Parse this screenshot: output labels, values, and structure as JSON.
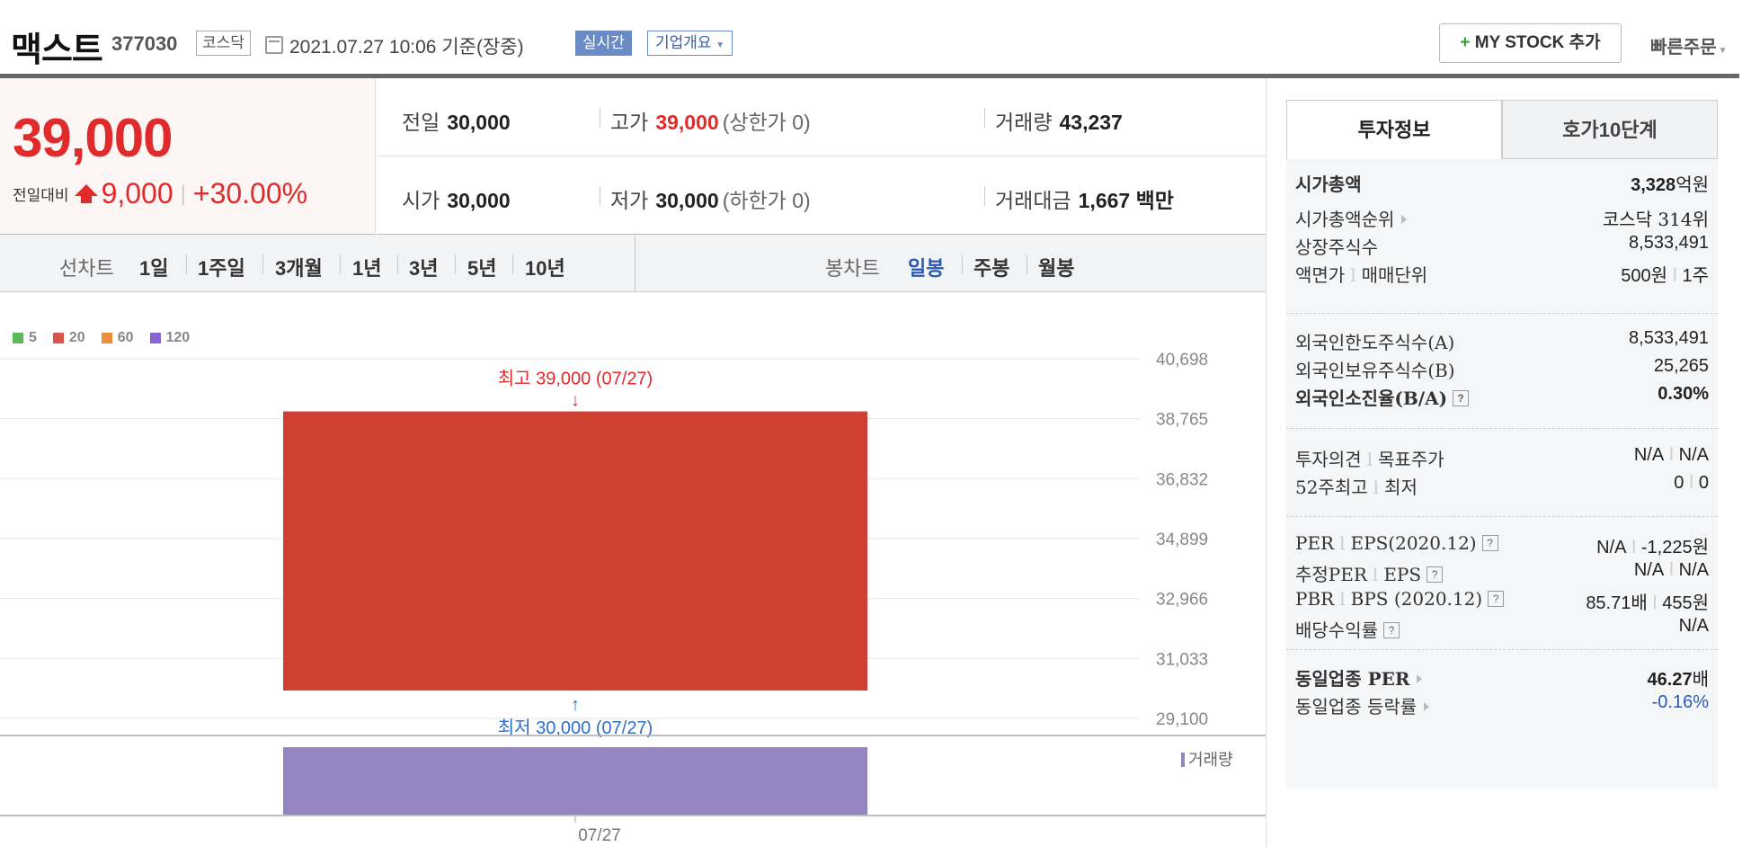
{
  "header": {
    "name": "맥스트",
    "code": "377030",
    "market": "코스닥",
    "datetime": "2021.07.27 10:06 기준(장중)",
    "realtime_label": "실시간",
    "overview_label": "기업개요",
    "mystock_plus": "+",
    "mystock_label": " MY STOCK 추가",
    "quick_order": "빠른주문"
  },
  "price": {
    "current": "39,000",
    "diff_label": "전일대비",
    "diff_value": "9,000",
    "diff_rate": "+30.00%"
  },
  "quote": {
    "prev_label": "전일",
    "prev": "30,000",
    "high_label": "고가",
    "high": "39,000",
    "upper_limit": "(상한가 0)",
    "volume_label": "거래량",
    "volume": "43,237",
    "open_label": "시가",
    "open": "30,000",
    "low_label": "저가",
    "low": "30,000",
    "lower_limit": "(하한가 0)",
    "amount_label": "거래대금",
    "amount": "1,667",
    "amount_unit": " 백만"
  },
  "period": {
    "line_label": "선차트",
    "line_items": [
      "1일",
      "1주일",
      "3개월",
      "1년",
      "3년",
      "5년",
      "10년"
    ],
    "candle_label": "봉차트",
    "candle_items": [
      "일봉",
      "주봉",
      "월봉"
    ],
    "candle_active": "일봉"
  },
  "chart_data": {
    "type": "candlestick",
    "moving_averages": [
      {
        "name": "5",
        "color": "#5cb85c"
      },
      {
        "name": "20",
        "color": "#d9534f"
      },
      {
        "name": "60",
        "color": "#e8913a"
      },
      {
        "name": "120",
        "color": "#8a63d2"
      }
    ],
    "y_ticks": [
      "40,698",
      "38,765",
      "36,832",
      "34,899",
      "32,966",
      "31,033",
      "29,100"
    ],
    "ylim": [
      29100,
      40698
    ],
    "candles": [
      {
        "date": "07/27",
        "open": 30000,
        "high": 39000,
        "low": 30000,
        "close": 39000,
        "color": "#cf4031"
      }
    ],
    "high_annotation": "최고 39,000 (07/27)",
    "low_annotation": "최저 30,000 (07/27)",
    "volume_label": "거래량",
    "volume_bar_color": "#9584c2",
    "x_labels": [
      "07/27"
    ]
  },
  "right_panel": {
    "tab_active": "투자정보",
    "tab_other": "호가10단계",
    "market_cap_label": "시가총액",
    "market_cap_value": "3,328",
    "market_cap_unit": "억원",
    "rank_label": "시가총액순위",
    "rank_value": "코스닥 314위",
    "shares_label": "상장주식수",
    "shares_value": "8,533,491",
    "par_label": "액면가",
    "trade_unit_label": "매매단위",
    "par_value": "500원",
    "trade_unit_value": "1주",
    "foreign_limit_label": "외국인한도주식수(A)",
    "foreign_limit_value": "8,533,491",
    "foreign_hold_label": "외국인보유주식수(B)",
    "foreign_hold_value": "25,265",
    "foreign_ratio_label": "외국인소진율(B/A)",
    "foreign_ratio_value": "0.30%",
    "opinion_label": "투자의견",
    "target_label": "목표주가",
    "opinion_value": "N/A",
    "target_value": "N/A",
    "w52_high_label": "52주최고",
    "w52_low_label": "최저",
    "w52_high_value": "0",
    "w52_low_value": "0",
    "per_label": "PER",
    "eps_label": "EPS(2020.12)",
    "per_value": "N/A",
    "eps_value": "-1,225원",
    "est_per_label": "추정PER",
    "est_eps_label": "EPS",
    "est_per_value": "N/A",
    "est_eps_value": "N/A",
    "pbr_label": "PBR",
    "bps_label": "BPS (2020.12)",
    "pbr_value": "85.71배",
    "bps_value": "455원",
    "dividend_label": "배당수익률",
    "dividend_value": "N/A",
    "industry_per_label": "동일업종 PER",
    "industry_per_value": "46.27",
    "industry_per_unit": "배",
    "industry_change_label": "동일업종 등락률",
    "industry_change_value": "-0.16%",
    "help_glyph": "?"
  }
}
